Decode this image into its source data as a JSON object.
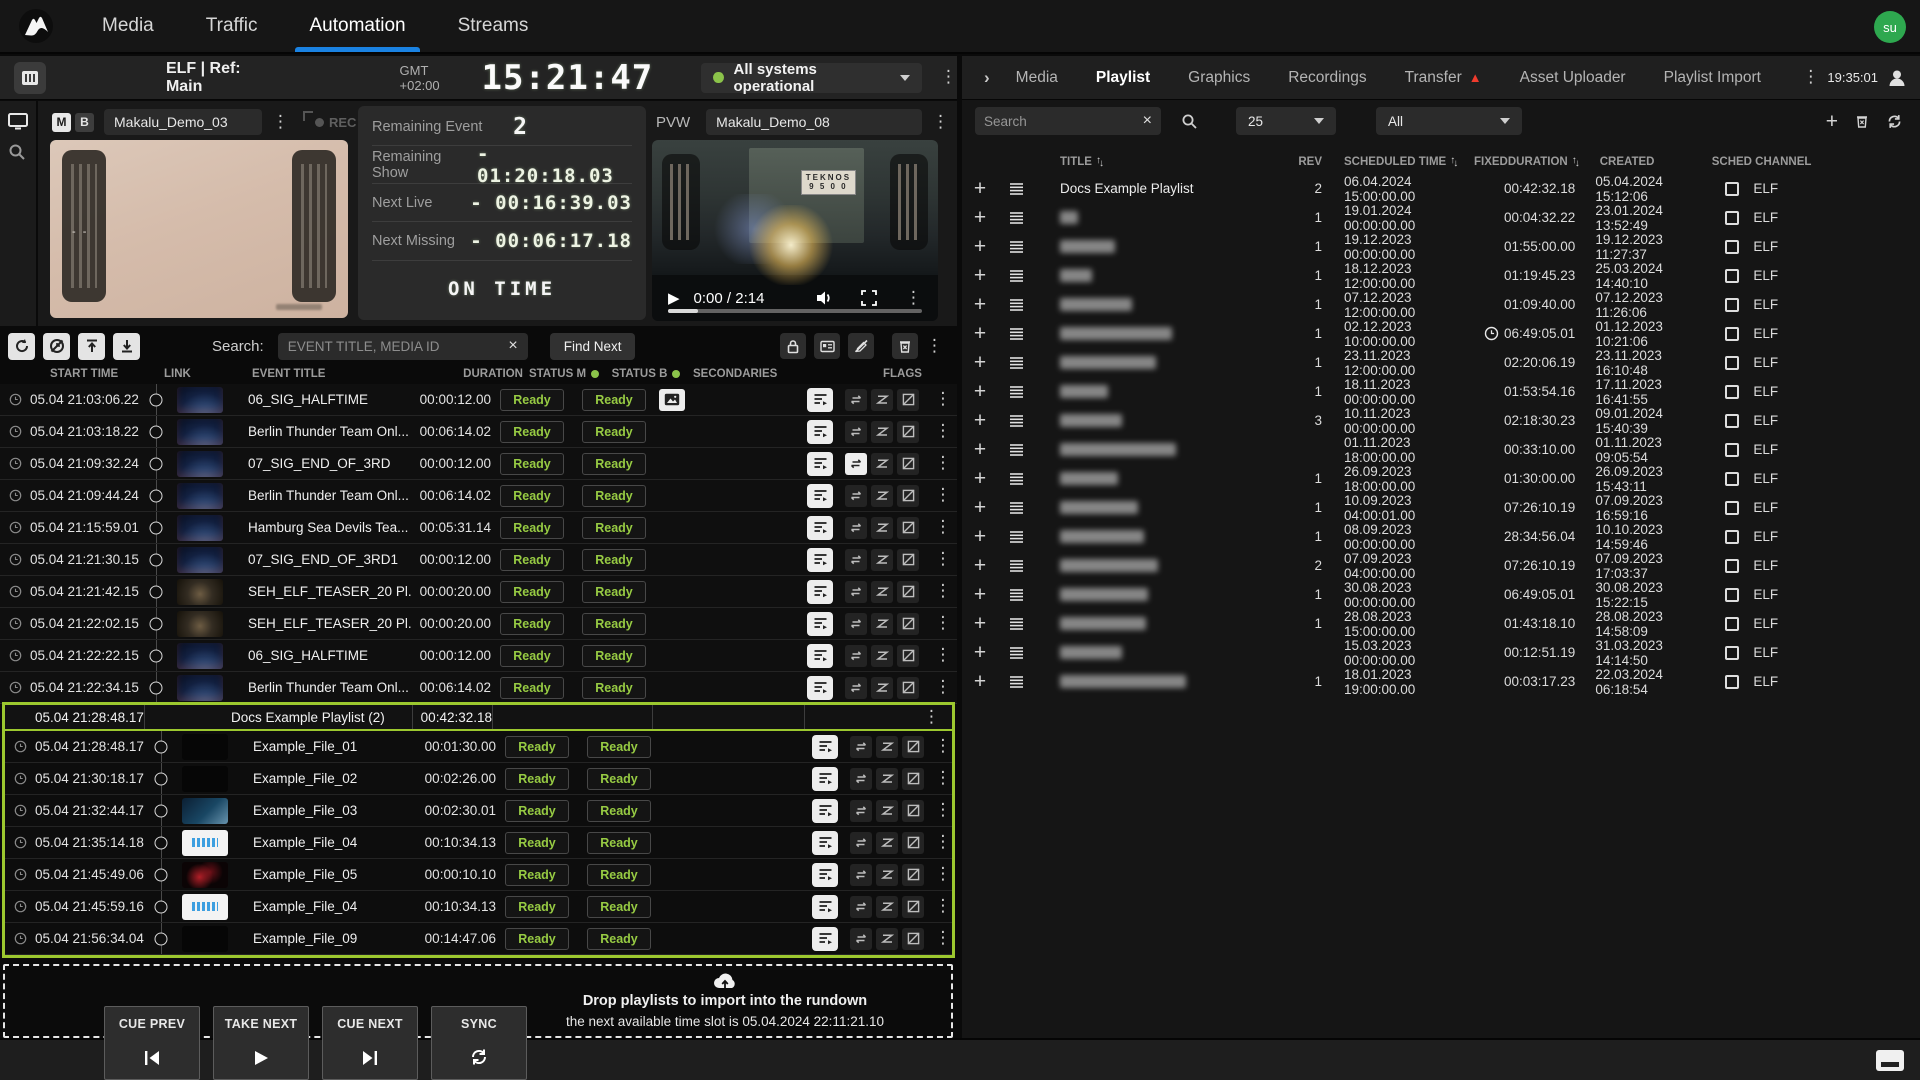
{
  "nav": {
    "items": [
      "Media",
      "Traffic",
      "Automation",
      "Streams"
    ],
    "active": "Automation",
    "avatar": "su"
  },
  "left": {
    "header": {
      "title": "ELF | Ref: Main",
      "gmt": "GMT +02:00",
      "clock": "15:21:47",
      "status": "All systems operational",
      "status_color": "#8bc34a"
    },
    "program": {
      "badge_m": "M",
      "badge_b": "B",
      "channel": "Makalu_Demo_03",
      "rec_label": "REC",
      "overlay_marks": "- -"
    },
    "timers": {
      "rows": [
        {
          "label": "Remaining Event",
          "value": "2",
          "big": true
        },
        {
          "label": "Remaining Show",
          "value": "- 01:20:18.03"
        },
        {
          "label": "Next Live",
          "value": "- 00:16:39.03"
        },
        {
          "label": "Next Missing",
          "value": "- 00:06:17.18"
        }
      ],
      "footer": "ON TIME"
    },
    "pvw": {
      "label": "PVW",
      "channel": "Makalu_Demo_08",
      "time": "0:00 / 2:14",
      "sign_line1": "TEKNOS",
      "sign_line2": "9 5 0 0"
    },
    "toolbar": {
      "search_label": "Search:",
      "search_placeholder": "EVENT TITLE, MEDIA ID",
      "find_next": "Find Next"
    },
    "columns": {
      "start": "START TIME",
      "link": "LINK",
      "title": "EVENT TITLE",
      "duration": "DURATION",
      "status_m": "STATUS M",
      "status_b": "STATUS B",
      "secondaries": "SECONDARIES",
      "flags": "FLAGS"
    },
    "rows": [
      {
        "start": "05.04 21:03:06.22",
        "title": "06_SIG_HALFTIME",
        "duration": "00:00:12.00",
        "status_m": "Ready",
        "status_b": "Ready",
        "thumb": "globe",
        "has_secondary": true,
        "loop_active": false
      },
      {
        "start": "05.04 21:03:18.22",
        "title": "Berlin Thunder Team Onl...",
        "duration": "00:06:14.02",
        "status_m": "Ready",
        "status_b": "Ready",
        "thumb": "globe",
        "has_secondary": false,
        "loop_active": false
      },
      {
        "start": "05.04 21:09:32.24",
        "title": "07_SIG_END_OF_3RD",
        "duration": "00:00:12.00",
        "status_m": "Ready",
        "status_b": "Ready",
        "thumb": "globe",
        "has_secondary": false,
        "loop_active": true
      },
      {
        "start": "05.04 21:09:44.24",
        "title": "Berlin Thunder Team Onl...",
        "duration": "00:06:14.02",
        "status_m": "Ready",
        "status_b": "Ready",
        "thumb": "globe",
        "has_secondary": false,
        "loop_active": false
      },
      {
        "start": "05.04 21:15:59.01",
        "title": "Hamburg Sea Devils Tea...",
        "duration": "00:05:31.14",
        "status_m": "Ready",
        "status_b": "Ready",
        "thumb": "globe",
        "has_secondary": false,
        "loop_active": false
      },
      {
        "start": "05.04 21:21:30.15",
        "title": "07_SIG_END_OF_3RD1",
        "duration": "00:00:12.00",
        "status_m": "Ready",
        "status_b": "Ready",
        "thumb": "globe",
        "has_secondary": false,
        "loop_active": false
      },
      {
        "start": "05.04 21:21:42.15",
        "title": "SEH_ELF_TEASER_20 Pl...",
        "duration": "00:00:20.00",
        "status_m": "Ready",
        "status_b": "Ready",
        "thumb": "teaser",
        "has_secondary": false,
        "loop_active": false
      },
      {
        "start": "05.04 21:22:02.15",
        "title": "SEH_ELF_TEASER_20 Pl...",
        "duration": "00:00:20.00",
        "status_m": "Ready",
        "status_b": "Ready",
        "thumb": "teaser",
        "has_secondary": false,
        "loop_active": false
      },
      {
        "start": "05.04 21:22:22.15",
        "title": "06_SIG_HALFTIME",
        "duration": "00:00:12.00",
        "status_m": "Ready",
        "status_b": "Ready",
        "thumb": "globe",
        "has_secondary": false,
        "loop_active": false
      },
      {
        "start": "05.04 21:22:34.15",
        "title": "Berlin Thunder Team Onl...",
        "duration": "00:06:14.02",
        "status_m": "Ready",
        "status_b": "Ready",
        "thumb": "globe",
        "has_secondary": false,
        "loop_active": false
      }
    ],
    "group": {
      "start": "05.04 21:28:48.17",
      "title": "Docs Example Playlist (2)",
      "duration": "00:42:32.18",
      "rows": [
        {
          "start": "05.04 21:28:48.17",
          "title": "Example_File_01",
          "duration": "00:01:30.00",
          "status_m": "Ready",
          "status_b": "Ready",
          "thumb": "black",
          "has_secondary": false,
          "loop_active": false
        },
        {
          "start": "05.04 21:30:18.17",
          "title": "Example_File_02",
          "duration": "00:02:26.00",
          "status_m": "Ready",
          "status_b": "Ready",
          "thumb": "black",
          "has_secondary": false,
          "loop_active": false
        },
        {
          "start": "05.04 21:32:44.17",
          "title": "Example_File_03",
          "duration": "00:02:30.01",
          "status_m": "Ready",
          "status_b": "Ready",
          "thumb": "ocean",
          "has_secondary": false,
          "loop_active": false
        },
        {
          "start": "05.04 21:35:14.18",
          "title": "Example_File_04",
          "duration": "00:10:34.13",
          "status_m": "Ready",
          "status_b": "Ready",
          "thumb": "white",
          "has_secondary": false,
          "loop_active": false
        },
        {
          "start": "05.04 21:45:49.06",
          "title": "Example_File_05",
          "duration": "00:00:10.10",
          "status_m": "Ready",
          "status_b": "Ready",
          "thumb": "red",
          "has_secondary": false,
          "loop_active": false
        },
        {
          "start": "05.04 21:45:59.16",
          "title": "Example_File_04",
          "duration": "00:10:34.13",
          "status_m": "Ready",
          "status_b": "Ready",
          "thumb": "white",
          "has_secondary": false,
          "loop_active": false
        },
        {
          "start": "05.04 21:56:34.04",
          "title": "Example_File_09",
          "duration": "00:14:47.06",
          "status_m": "Ready",
          "status_b": "Ready",
          "thumb": "black",
          "has_secondary": false,
          "loop_active": false
        }
      ]
    },
    "dropzone": {
      "line1": "Drop playlists to import into the rundown",
      "line2": "the next available time slot is 05.04.2024 22:11:21.10"
    },
    "transport": [
      {
        "label": "CUE PREV"
      },
      {
        "label": "TAKE NEXT"
      },
      {
        "label": "CUE NEXT"
      },
      {
        "label": "SYNC"
      }
    ]
  },
  "right": {
    "tabs": [
      "Media",
      "Playlist",
      "Graphics",
      "Recordings",
      "Transfer",
      "Asset Uploader",
      "Playlist Import"
    ],
    "active": "Playlist",
    "warning_tab": "Transfer",
    "time": "19:35:01",
    "filters": {
      "search_placeholder": "Search",
      "page_size": "25",
      "filter_all": "All"
    },
    "columns": {
      "title": "TITLE",
      "rev": "REV",
      "scheduled": "SCHEDULED TIME",
      "fixed": "FIXED",
      "duration": "DURATION",
      "created": "CREATED",
      "channel": "SCHED CHANNEL"
    },
    "rows": [
      {
        "title": "Docs Example Playlist",
        "rev": "2",
        "scheduled": "06.04.2024 15:00:00.00",
        "fixed": false,
        "duration": "00:42:32.18",
        "created": "05.04.2024 15:12:06",
        "channel": "ELF"
      },
      {
        "title": "",
        "blur_width": 18,
        "rev": "1",
        "scheduled": "19.01.2024 00:00:00.00",
        "fixed": false,
        "duration": "00:04:32.22",
        "created": "23.01.2024 13:52:49",
        "channel": "ELF"
      },
      {
        "title": "",
        "blur_width": 55,
        "rev": "1",
        "scheduled": "19.12.2023 00:00:00.00",
        "fixed": false,
        "duration": "01:55:00.00",
        "created": "19.12.2023 11:27:37",
        "channel": "ELF"
      },
      {
        "title": "",
        "blur_width": 32,
        "rev": "1",
        "scheduled": "18.12.2023 12:00:00.00",
        "fixed": false,
        "duration": "01:19:45.23",
        "created": "25.03.2024 14:40:10",
        "channel": "ELF"
      },
      {
        "title": "",
        "blur_width": 72,
        "rev": "1",
        "scheduled": "07.12.2023 12:00:00.00",
        "fixed": false,
        "duration": "01:09:40.00",
        "created": "07.12.2023 11:26:06",
        "channel": "ELF"
      },
      {
        "title": "",
        "blur_width": 112,
        "rev": "1",
        "scheduled": "02.12.2023 10:00:00.00",
        "fixed": true,
        "duration": "06:49:05.01",
        "created": "01.12.2023 10:21:06",
        "channel": "ELF"
      },
      {
        "title": "",
        "blur_width": 96,
        "rev": "1",
        "scheduled": "23.11.2023 12:00:00.00",
        "fixed": false,
        "duration": "02:20:06.19",
        "created": "23.11.2023 16:10:48",
        "channel": "ELF"
      },
      {
        "title": "",
        "blur_width": 48,
        "rev": "1",
        "scheduled": "18.11.2023 00:00:00.00",
        "fixed": false,
        "duration": "01:53:54.16",
        "created": "17.11.2023 16:41:55",
        "channel": "ELF"
      },
      {
        "title": "",
        "blur_width": 62,
        "rev": "3",
        "scheduled": "10.11.2023 00:00:00.00",
        "fixed": false,
        "duration": "02:18:30.23",
        "created": "09.01.2024 15:40:39",
        "channel": "ELF"
      },
      {
        "title": "",
        "blur_width": 116,
        "rev": "",
        "scheduled": "01.11.2023 18:00:00.00",
        "fixed": false,
        "duration": "00:33:10.00",
        "created": "01.11.2023 09:05:54",
        "channel": "ELF"
      },
      {
        "title": "",
        "blur_width": 58,
        "rev": "1",
        "scheduled": "26.09.2023 18:00:00.00",
        "fixed": false,
        "duration": "01:30:00.00",
        "created": "26.09.2023 15:43:11",
        "channel": "ELF"
      },
      {
        "title": "",
        "blur_width": 78,
        "rev": "1",
        "scheduled": "10.09.2023 04:00:01.00",
        "fixed": false,
        "duration": "07:26:10.19",
        "created": "07.09.2023 16:59:16",
        "channel": "ELF"
      },
      {
        "title": "",
        "blur_width": 84,
        "rev": "1",
        "scheduled": "08.09.2023 00:00:00.00",
        "fixed": false,
        "duration": "28:34:56.04",
        "created": "10.10.2023 14:59:46",
        "channel": "ELF"
      },
      {
        "title": "",
        "blur_width": 98,
        "rev": "2",
        "scheduled": "07.09.2023 04:00:00.00",
        "fixed": false,
        "duration": "07:26:10.19",
        "created": "07.09.2023 17:03:37",
        "channel": "ELF"
      },
      {
        "title": "",
        "blur_width": 88,
        "rev": "1",
        "scheduled": "30.08.2023 00:00:00.00",
        "fixed": false,
        "duration": "06:49:05.01",
        "created": "30.08.2023 15:22:15",
        "channel": "ELF"
      },
      {
        "title": "",
        "blur_width": 86,
        "rev": "1",
        "scheduled": "28.08.2023 15:00:00.00",
        "fixed": false,
        "duration": "01:43:18.10",
        "created": "28.08.2023 14:58:09",
        "channel": "ELF"
      },
      {
        "title": "",
        "blur_width": 62,
        "rev": "",
        "scheduled": "15.03.2023 00:00:00.00",
        "fixed": false,
        "duration": "00:12:51.19",
        "created": "31.03.2023 14:14:50",
        "channel": "ELF"
      },
      {
        "title": "",
        "blur_width": 126,
        "rev": "1",
        "scheduled": "18.01.2023 19:00:00.00",
        "fixed": false,
        "duration": "00:03:17.23",
        "created": "22.03.2024 06:18:54",
        "channel": "ELF"
      }
    ]
  }
}
